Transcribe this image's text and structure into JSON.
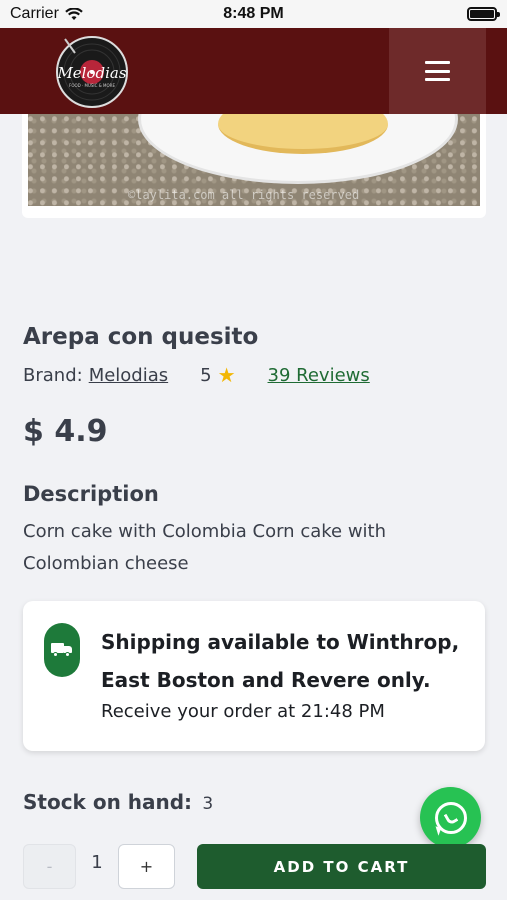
{
  "status_bar": {
    "carrier": "Carrier",
    "time": "8:48 PM"
  },
  "header": {
    "logo_text": "Melodias",
    "menu_icon": "hamburger-menu-icon"
  },
  "product": {
    "image_watermark": "©laylita.com all rights reserved",
    "title": "Arepa con quesito",
    "brand_label": "Brand:",
    "brand_name": "Melodias",
    "rating": "5",
    "reviews": "39 Reviews",
    "price": "$ 4.9",
    "description_title": "Description",
    "description": "Corn cake with Colombia Corn cake with Colombian cheese"
  },
  "shipping": {
    "icon": "truck-icon",
    "headline": "Shipping available to Winthrop, East Boston and Revere only.",
    "subtext": "Receive your order at 21:48 PM"
  },
  "stock": {
    "label": "Stock on hand:",
    "value": "3"
  },
  "purchase": {
    "minus_label": "-",
    "quantity": "1",
    "plus_label": "+",
    "add_to_cart": "ADD TO CART"
  },
  "colors": {
    "header_bg": "#5a1111",
    "accent_green": "#1e5c2e",
    "whatsapp_green": "#27c253",
    "star": "#f2b705"
  }
}
